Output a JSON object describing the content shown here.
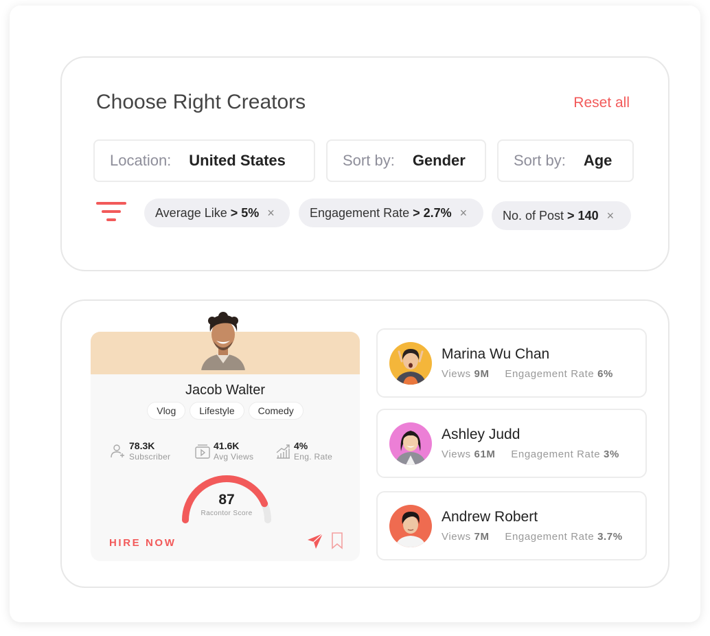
{
  "filters": {
    "title": "Choose Right Creators",
    "reset_label": "Reset all",
    "location": {
      "label": "Location:",
      "value": "United States"
    },
    "sort_gender": {
      "label": "Sort by:",
      "value": "Gender"
    },
    "sort_age": {
      "label": "Sort by:",
      "value": "Age"
    },
    "chips": [
      {
        "label": "Average Like",
        "value": "> 5%"
      },
      {
        "label": "Engagement Rate",
        "value": "> 2.7%"
      },
      {
        "label": "No. of Post",
        "value": "> 140"
      }
    ],
    "chip_close": "×",
    "accent_color": "#f25a5a"
  },
  "featured": {
    "name": "Jacob Walter",
    "tags": [
      "Vlog",
      "Lifestyle",
      "Comedy"
    ],
    "stats": [
      {
        "value": "78.3K",
        "label": "Subscriber",
        "icon": "user-add-icon"
      },
      {
        "value": "41.6K",
        "label": "Avg Views",
        "icon": "video-play-icon"
      },
      {
        "value": "4%",
        "label": "Eng. Rate",
        "icon": "growth-chart-icon"
      }
    ],
    "score": "87",
    "score_label": "Racontor Score",
    "score_fraction": 0.87,
    "hire_label": "HIRE NOW",
    "banner_color": "#f5dcbc"
  },
  "creators": [
    {
      "name": "Marina Wu Chan",
      "views_label": "Views",
      "views": "9M",
      "eng_label": "Engagement Rate",
      "eng": "6%",
      "avatar_bg": "#f4b63a"
    },
    {
      "name": "Ashley Judd",
      "views_label": "Views",
      "views": "61M",
      "eng_label": "Engagement Rate",
      "eng": "3%",
      "avatar_bg": "#ec7fd6"
    },
    {
      "name": "Andrew Robert",
      "views_label": "Views",
      "views": "7M",
      "eng_label": "Engagement Rate",
      "eng": "3.7%",
      "avatar_bg": "#ef6b50"
    }
  ]
}
